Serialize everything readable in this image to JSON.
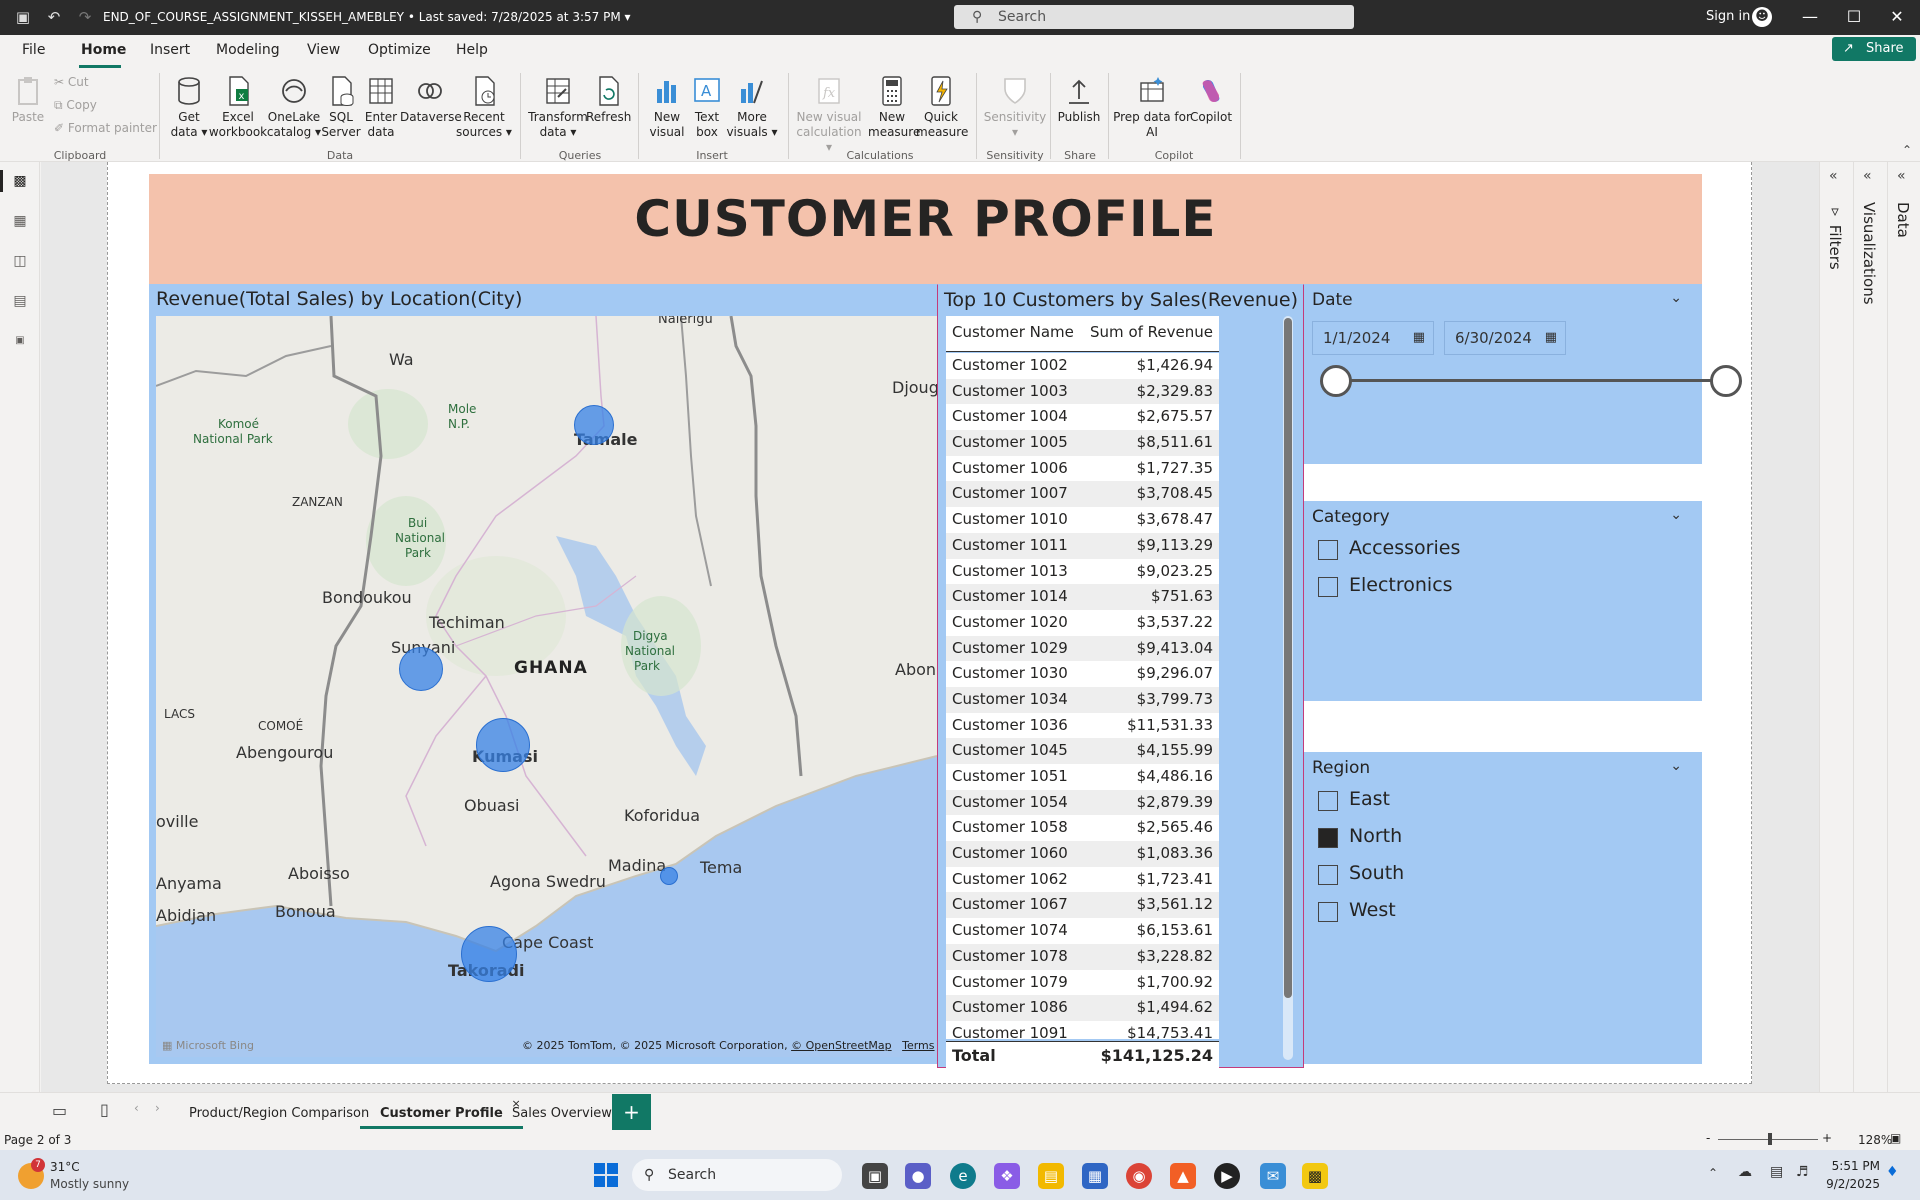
{
  "titlebar": {
    "doc_title": "END_OF_COURSE_ASSIGNMENT_KISSEH_AMEBLEY",
    "saved": "• Last saved: 7/28/2025 at 3:57 PM",
    "search_placeholder": "Search",
    "sign_in": "Sign in"
  },
  "menu": {
    "items": [
      "File",
      "Home",
      "Insert",
      "Modeling",
      "View",
      "Optimize",
      "Help"
    ],
    "share": "Share"
  },
  "ribbon": {
    "clipboard": {
      "paste": "Paste",
      "cut": "Cut",
      "copy": "Copy",
      "format_painter": "Format painter",
      "group": "Clipboard"
    },
    "data": {
      "group": "Data",
      "buttons": [
        {
          "l1": "Get",
          "l2": "data ▾"
        },
        {
          "l1": "Excel",
          "l2": "workbook"
        },
        {
          "l1": "OneLake",
          "l2": "catalog ▾"
        },
        {
          "l1": "SQL",
          "l2": "Server"
        },
        {
          "l1": "Enter",
          "l2": "data"
        },
        {
          "l1": "Dataverse",
          "l2": ""
        },
        {
          "l1": "Recent",
          "l2": "sources ▾"
        }
      ]
    },
    "queries": {
      "group": "Queries",
      "transform_l1": "Transform",
      "transform_l2": "data ▾",
      "refresh": "Refresh"
    },
    "insert": {
      "group": "Insert",
      "new_visual_l1": "New",
      "new_visual_l2": "visual",
      "text_box_l1": "Text",
      "text_box_l2": "box",
      "more_visuals_l1": "More",
      "more_visuals_l2": "visuals ▾"
    },
    "calculations": {
      "group": "Calculations",
      "new_visual_calc_l1": "New visual",
      "new_visual_calc_l2": "calculation ▾",
      "new_measure_l1": "New",
      "new_measure_l2": "measure",
      "quick_measure_l1": "Quick",
      "quick_measure_l2": "measure"
    },
    "sensitivity": {
      "group": "Sensitivity",
      "label": "Sensitivity",
      "sub": "▾"
    },
    "share": {
      "group": "Share",
      "publish": "Publish"
    },
    "copilot": {
      "group": "Copilot",
      "prep_l1": "Prep data for",
      "prep_l2": "AI",
      "copilot": "Copilot"
    }
  },
  "report": {
    "banner_title": "CUSTOMER PROFILE",
    "map": {
      "title": "Revenue(Total Sales) by Location(City)",
      "labels": {
        "nalerigu": "Nalerigu",
        "wa": "Wa",
        "mole": "Mole",
        "mole2": "N.P.",
        "komoe": "Komoé",
        "komoe2": "National Park",
        "tamale": "Tamale",
        "djoug": "Djoug",
        "zanzan": "ZANZAN",
        "bui": "Bui",
        "bui2": "National",
        "bui3": "Park",
        "bondoukou": "Bondoukou",
        "techiman": "Techiman",
        "sunyani": "Sunyani",
        "ghana": "GHANA",
        "digya": "Digya",
        "digya2": "National",
        "digya3": "Park",
        "abon": "Abon",
        "lacs": "LACS",
        "comoe": "COMOÉ",
        "abengourou": "Abengourou",
        "kumasi": "Kumasi",
        "obuasi": "Obuasi",
        "koforidua": "Koforidua",
        "oville": "oville",
        "aboisso": "Aboisso",
        "agona": "Agona Swedru",
        "madina": "Madina",
        "tema": "Tema",
        "anyama": "Anyama",
        "bonoua": "Bonoua",
        "abidjan": "Abidjan",
        "cape_coast": "Cape Coast",
        "takoradi": "Takoradi"
      },
      "credit": "© 2025 TomTom, © 2025 Microsoft Corporation,",
      "osm": "© OpenStreetMap",
      "terms": "Terms",
      "bing": "Microsoft Bing"
    },
    "table": {
      "title": "Top 10 Customers by Sales(Revenue)",
      "col_name": "Customer Name",
      "col_rev": "Sum of Revenue",
      "rows": [
        [
          "Customer 1002",
          "$1,426.94"
        ],
        [
          "Customer 1003",
          "$2,329.83"
        ],
        [
          "Customer 1004",
          "$2,675.57"
        ],
        [
          "Customer 1005",
          "$8,511.61"
        ],
        [
          "Customer 1006",
          "$1,727.35"
        ],
        [
          "Customer 1007",
          "$3,708.45"
        ],
        [
          "Customer 1010",
          "$3,678.47"
        ],
        [
          "Customer 1011",
          "$9,113.29"
        ],
        [
          "Customer 1013",
          "$9,023.25"
        ],
        [
          "Customer 1014",
          "$751.63"
        ],
        [
          "Customer 1020",
          "$3,537.22"
        ],
        [
          "Customer 1029",
          "$9,413.04"
        ],
        [
          "Customer 1030",
          "$9,296.07"
        ],
        [
          "Customer 1034",
          "$3,799.73"
        ],
        [
          "Customer 1036",
          "$11,531.33"
        ],
        [
          "Customer 1045",
          "$4,155.99"
        ],
        [
          "Customer 1051",
          "$4,486.16"
        ],
        [
          "Customer 1054",
          "$2,879.39"
        ],
        [
          "Customer 1058",
          "$2,565.46"
        ],
        [
          "Customer 1060",
          "$1,083.36"
        ],
        [
          "Customer 1062",
          "$1,723.41"
        ],
        [
          "Customer 1067",
          "$3,561.12"
        ],
        [
          "Customer 1074",
          "$6,153.61"
        ],
        [
          "Customer 1078",
          "$3,228.82"
        ],
        [
          "Customer 1079",
          "$1,700.92"
        ],
        [
          "Customer 1086",
          "$1,494.62"
        ],
        [
          "Customer 1091",
          "$14,753.41"
        ]
      ],
      "total_label": "Total",
      "total_value": "$141,125.24"
    },
    "date_slicer": {
      "title": "Date",
      "start": "1/1/2024",
      "end": "6/30/2024"
    },
    "category_slicer": {
      "title": "Category",
      "options": [
        {
          "label": "Accessories",
          "checked": false
        },
        {
          "label": "Electronics",
          "checked": false
        }
      ]
    },
    "region_slicer": {
      "title": "Region",
      "options": [
        {
          "label": "East",
          "checked": false
        },
        {
          "label": "North",
          "checked": true
        },
        {
          "label": "South",
          "checked": false
        },
        {
          "label": "West",
          "checked": false
        }
      ]
    }
  },
  "panes": {
    "filters": "Filters",
    "visualizations": "Visualizations",
    "data": "Data"
  },
  "tabs": {
    "items": [
      "Product/Region Comparison",
      "Customer Profile",
      "Sales Overview"
    ],
    "active": "Customer Profile",
    "close": "×",
    "add": "+"
  },
  "status": {
    "page": "Page 2 of 3",
    "zoom": "128%",
    "zoom_minus": "-",
    "zoom_plus": "+"
  },
  "taskbar": {
    "temp": "31°C",
    "weather": "Mostly sunny",
    "badge": "7",
    "search": "Search",
    "time": "5:51 PM",
    "date": "9/2/2025"
  },
  "colors": {
    "accent": "#117865",
    "banner": "#f4c2ac",
    "visual_bg": "#a3c9f3",
    "bubble": "#3782e6"
  }
}
